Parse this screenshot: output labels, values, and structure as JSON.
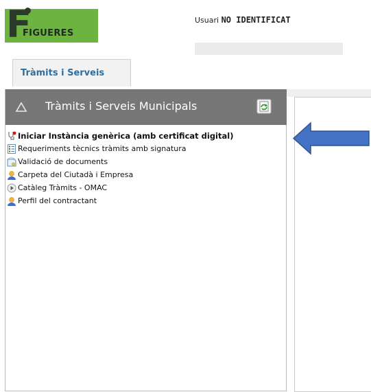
{
  "brand": {
    "logo_text": "FIGUERES"
  },
  "header": {
    "user_label": "Usuari",
    "user_name": "NO IDENTIFICAT"
  },
  "tabs": [
    {
      "label": "Tràmits i Serveis"
    }
  ],
  "panel": {
    "title": "Tràmits i Serveis Municipals",
    "items": [
      {
        "label": "Iniciar Instància genèrica (amb certificat digital)",
        "icon": "stethoscope-icon",
        "bold": true
      },
      {
        "label": "Requeriments tècnics tràmits amb signatura",
        "icon": "list-document-icon"
      },
      {
        "label": "Validació de documents",
        "icon": "certificate-document-icon"
      },
      {
        "label": "Carpeta del Ciutadà i Empresa",
        "icon": "user-icon"
      },
      {
        "label": "Catàleg Tràmits - OMAC",
        "icon": "play-circle-icon"
      },
      {
        "label": "Perfil del contractant",
        "icon": "user-icon"
      }
    ]
  },
  "colors": {
    "accent_arrow": "#4472c4",
    "brand_green": "#6db33f",
    "panel_header": "#777777",
    "tab_text": "#2d6fa3"
  }
}
